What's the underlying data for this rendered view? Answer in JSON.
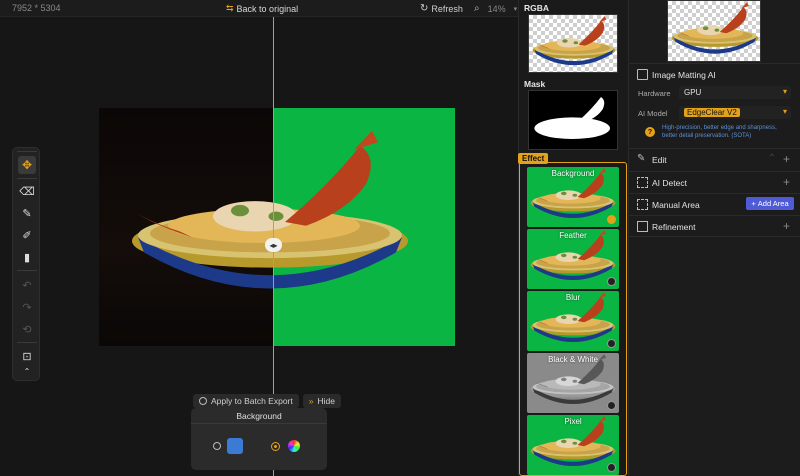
{
  "topbar": {
    "dimensions": "7952 * 5304",
    "back_label": "Back to original",
    "refresh_label": "Refresh",
    "zoom": "14%"
  },
  "canvas": {
    "apply_batch_label": "Apply to Batch Export",
    "hide_label": "Hide",
    "background_panel_title": "Background"
  },
  "effects": {
    "rgba_label": "RGBA",
    "mask_label": "Mask",
    "effect_label": "Effect",
    "items": [
      {
        "label": "Background",
        "selected": true
      },
      {
        "label": "Feather",
        "selected": false
      },
      {
        "label": "Blur",
        "selected": false
      },
      {
        "label": "Black & White",
        "selected": false
      },
      {
        "label": "Pixel",
        "selected": false
      }
    ]
  },
  "right": {
    "section_title": "Image Matting AI",
    "hardware_label": "Hardware",
    "hardware_value": "GPU",
    "ai_model_label": "AI Model",
    "ai_model_value": "EdgeClear  V2",
    "model_description": "High-precision, better edge and sharpness, better detail preservation. (SOTA)",
    "edit_label": "Edit",
    "ai_detect_label": "AI Detect",
    "manual_area_label": "Manual Area",
    "add_area_label": "Add Area",
    "refinement_label": "Refinement"
  },
  "colors": {
    "accent": "#e3a21a",
    "green_screen": "#0bb543",
    "add_area_button": "#4f5bd5"
  }
}
